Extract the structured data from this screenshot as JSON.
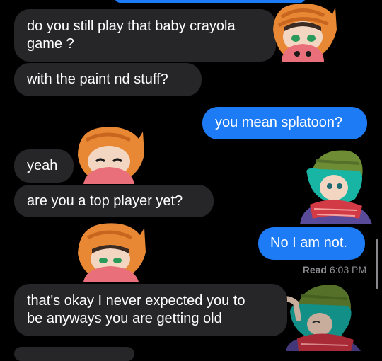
{
  "messages": {
    "m1": {
      "line1": "do you still play that baby crayola",
      "line2": "game ?"
    },
    "m2": "with the paint nd stuff?",
    "m3": "you mean splatoon?",
    "m4": "yeah",
    "m5": "are you a top player yet?",
    "m6": "No I am not.",
    "m7": {
      "line1": "that's okay I never expected you to",
      "line2": "be anyways you are getting old"
    }
  },
  "receipt": {
    "label": "Read",
    "time": "6:03 PM"
  },
  "stickers": {
    "cat_kid": "orange-cat-hood-kid-sticker",
    "green_kid": "green-hat-scarf-kid-sticker"
  },
  "colors": {
    "incoming": "#262629",
    "outgoing": "#1d7cf5",
    "background": "#000000"
  }
}
